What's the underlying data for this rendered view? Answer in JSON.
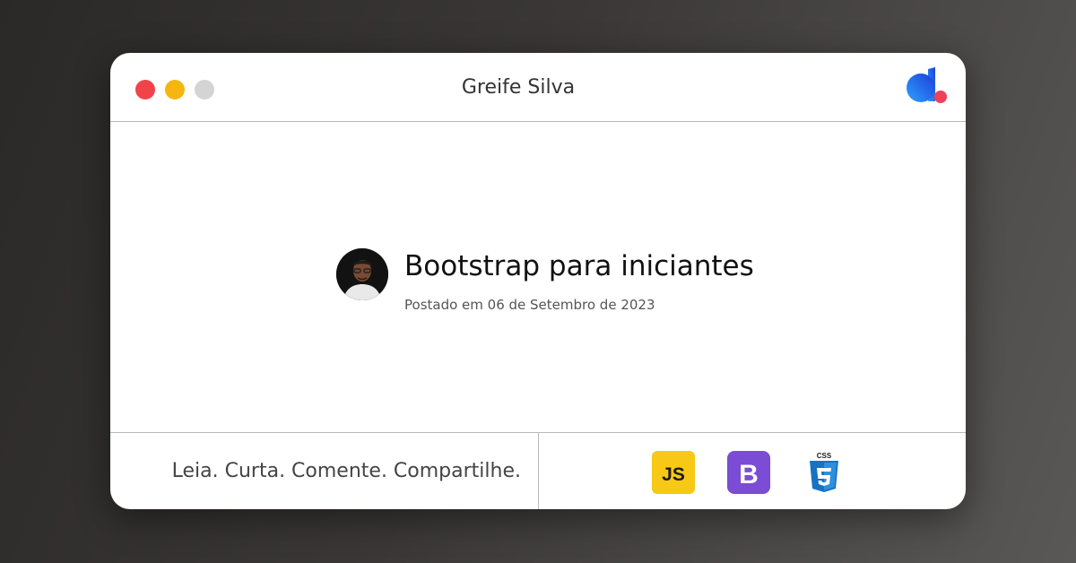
{
  "window": {
    "title": "Greife Silva",
    "controls": [
      "close",
      "minimize",
      "zoom"
    ],
    "brand_icon": "logo-icon"
  },
  "post": {
    "title": "Bootstrap para iniciantes",
    "date": "Postado em 06 de Setembro de 2023",
    "avatar_icon": "author-avatar"
  },
  "footer": {
    "tagline": "Leia. Curta. Comente. Compartilhe.",
    "tech_icons": [
      {
        "name": "javascript-icon",
        "label": "JS",
        "color": "#f7c916"
      },
      {
        "name": "bootstrap-icon",
        "label": "B",
        "color": "#7b4cd5"
      },
      {
        "name": "css3-icon",
        "label": "CSS",
        "color": "#1673c4"
      }
    ]
  },
  "colors": {
    "close": "#f2434a",
    "minimize": "#f5b70f",
    "zoom": "#d4d4d4"
  }
}
